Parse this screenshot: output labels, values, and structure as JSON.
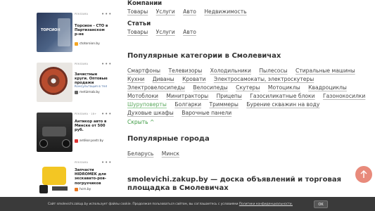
{
  "sidebar": {
    "ads": [
      {
        "tag": "РЕКЛАМА",
        "title": "Торсион - СТО в Партизанском р-не",
        "sub": "",
        "source": "ctotorsion.by"
      },
      {
        "tag": "РЕКЛАМА",
        "title": "Зачистные круги. Оптовые продажи",
        "sub": "Консультация в тел",
        "source": "metizmab.by"
      },
      {
        "tag": "РЕКЛАМА · 18+",
        "title": "Антикор авто в Минске от 500 руб.",
        "sub": "",
        "source": "antikor.postr.by"
      },
      {
        "tag": "РЕКЛАМА",
        "title": "Запчасти HIDROMEK для экскавато-ров-погрузчиков",
        "sub": "",
        "source": "hcm.by"
      }
    ]
  },
  "companies": {
    "heading": "Компании",
    "links": [
      "Товары",
      "Услуги",
      "Авто",
      "Недвижимость"
    ]
  },
  "articles": {
    "heading": "Статьи",
    "links": [
      "Товары",
      "Услуги",
      "Авто"
    ]
  },
  "popular_categories": {
    "heading": "Популярные категории в Смолевичах",
    "rows": [
      [
        "Смартфоны",
        "Телевизоры",
        "Холодильники",
        "Пылесосы",
        "Стиральные машины"
      ],
      [
        "Кухни",
        "Диваны",
        "Кровати",
        "Электросамокаты, электроскутеры"
      ],
      [
        "Электровелосипеды",
        "Велосипеды",
        "Скутеры",
        "Мотоциклы",
        "Квадроциклы"
      ],
      [
        "Мотоблоки",
        "Минитракторы",
        "Прицепы",
        "Газосиликатные блоки",
        "Газонокосилки"
      ],
      [
        "Шуруповерты",
        "Болгарки",
        "Триммеры",
        "Бурение скважин на воду"
      ],
      [
        "Духовые шкафы",
        "Варочные панели"
      ]
    ],
    "hide_label": "Скрыть ^"
  },
  "popular_cities": {
    "heading": "Популярные города",
    "links": [
      "Беларусь",
      "Минск"
    ]
  },
  "seo_title": "smolevichi.zakup.by — доска объявлений и торговая площадка в Смолевичах",
  "scroll_top_icon": "arrow-up-icon",
  "cookie": {
    "text": "Сайт smolevichi.zakup.by использует файлы cookie. Продолжая пользоваться сайтом, вы соглашаетесь с условиями ",
    "link": "Политики конфиденциальности.",
    "ok": "OK"
  }
}
